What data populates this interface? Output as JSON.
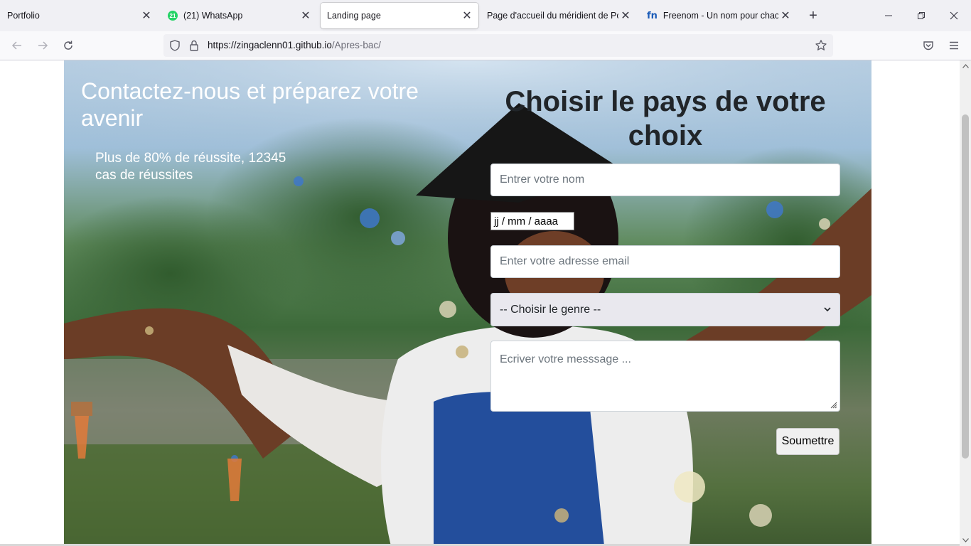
{
  "browser": {
    "tabs": [
      {
        "title": "Portfolio",
        "favicon": "none",
        "active": false
      },
      {
        "title": "(21) WhatsApp",
        "favicon": "whatsapp-icon",
        "badge": "21",
        "active": false
      },
      {
        "title": "Landing page",
        "favicon": "none",
        "active": true
      },
      {
        "title": "Page d'accueil du méridient de Port",
        "favicon": "none",
        "active": false
      },
      {
        "title": "Freenom - Un nom pour chacun",
        "favicon": "freenom-icon",
        "favicon_text": "fn",
        "active": false
      }
    ],
    "new_tab_symbol": "+",
    "url_host": "https://zingaclenn01.github.io",
    "url_path": "/Apres-bac/"
  },
  "page": {
    "left_title": "Contactez-nous et préparez votre avenir",
    "left_subtitle": "Plus de 80% de réussite, 12345 cas de réussites",
    "form_title": "Choisir le pays de votre choix",
    "name_placeholder": "Entrer votre nom",
    "date_placeholder": "jj / mm / aaaa",
    "email_placeholder": "Enter votre adresse email",
    "gender_select": "-- Choisir le genre --",
    "message_placeholder": "Ecriver votre messsage ...",
    "submit_label": "Soumettre"
  },
  "colors": {
    "tabbar_bg": "#f0f0f4",
    "form_title": "#212529",
    "hero_text": "#ffffff"
  }
}
